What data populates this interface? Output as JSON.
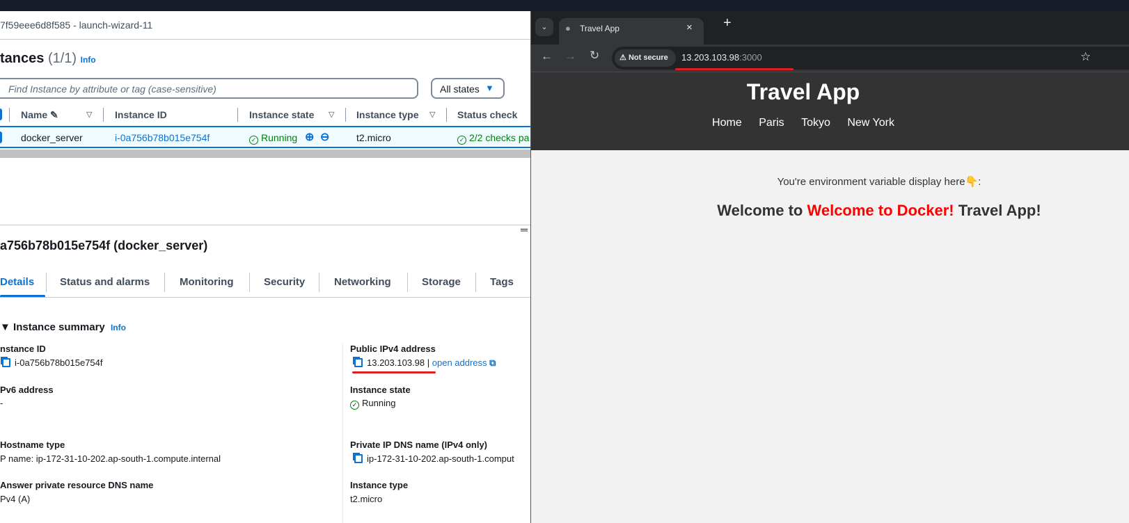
{
  "aws": {
    "security_group": "7f59eee6d8f585 - launch-wizard-11",
    "instances_title": "tances",
    "instances_count": "(1/1)",
    "info": "Info",
    "search_placeholder": "Find Instance by attribute or tag (case-sensitive)",
    "state_filter": "All states",
    "columns": [
      "Name",
      "Instance ID",
      "Instance state",
      "Instance type",
      "Status check"
    ],
    "row": {
      "name": "docker_server",
      "id": "i-0a756b78b015e754f",
      "state": "Running",
      "type": "t2.micro",
      "status": "2/2 checks pa"
    },
    "detail_title": "a756b78b015e754f (docker_server)",
    "tabs": [
      "Details",
      "Status and alarms",
      "Monitoring",
      "Security",
      "Networking",
      "Storage",
      "Tags"
    ],
    "summary_title": "Instance summary",
    "fields": {
      "instance_id_label": "nstance ID",
      "instance_id": "i-0a756b78b015e754f",
      "ipv6_label": "Pv6 address",
      "ipv6": "-",
      "hostname_label": "Hostname type",
      "hostname": "P name: ip-172-31-10-202.ap-south-1.compute.internal",
      "answer_label": "Answer private resource DNS name",
      "answer": "Pv4 (A)",
      "public_ip_label": "Public IPv4 address",
      "public_ip": "13.203.103.98",
      "open_address": "open address",
      "state_label": "Instance state",
      "state": "Running",
      "private_dns_label": "Private IP DNS name (IPv4 only)",
      "private_dns": "ip-172-31-10-202.ap-south-1.comput",
      "type_label": "Instance type",
      "type": "t2.micro"
    }
  },
  "browser": {
    "tab_title": "Travel App",
    "not_secure": "Not secure",
    "url_host": "13.203.103.98",
    "url_port": ":3000",
    "page": {
      "title": "Travel App",
      "nav": [
        "Home",
        "Paris",
        "Tokyo",
        "New York"
      ],
      "env_text": "You're environment variable display here👇:",
      "welcome_pre": "Welcome to ",
      "welcome_red": "Welcome to Docker!",
      "welcome_post": " Travel App!"
    }
  },
  "colors": {
    "accent": "#0972d3",
    "running": "#037f0c",
    "highlight": "#e21d1d"
  }
}
